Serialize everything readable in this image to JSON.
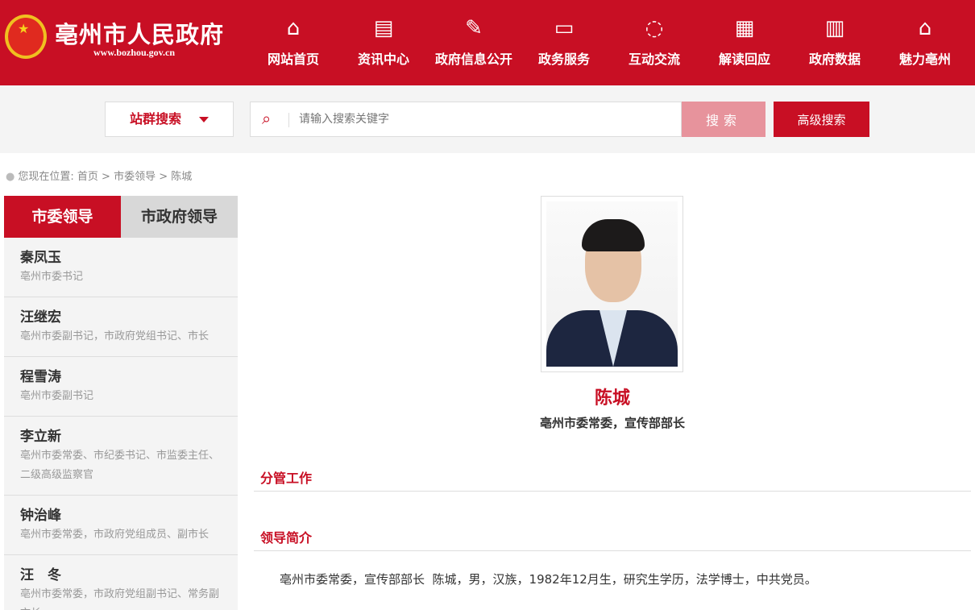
{
  "header": {
    "title": "亳州市人民政府",
    "url": "www.bozhou.gov.cn",
    "nav": [
      {
        "label": "网站首页",
        "icon": "home-icon",
        "glyph": "⌂"
      },
      {
        "label": "资讯中心",
        "icon": "news-icon",
        "glyph": "▤"
      },
      {
        "label": "政府信息公开",
        "icon": "edit-doc-icon",
        "glyph": "✎"
      },
      {
        "label": "政务服务",
        "icon": "monitor-icon",
        "glyph": "▭"
      },
      {
        "label": "互动交流",
        "icon": "chat-icon",
        "glyph": "◌"
      },
      {
        "label": "解读回应",
        "icon": "document-icon",
        "glyph": "▦"
      },
      {
        "label": "政府数据",
        "icon": "bar-chart-icon",
        "glyph": "▥"
      },
      {
        "label": "魅力亳州",
        "icon": "landmark-icon",
        "glyph": "⌂"
      }
    ]
  },
  "search": {
    "site_select": "站群搜索",
    "placeholder": "请输入搜索关键字",
    "value": "",
    "button": "搜索",
    "advanced": "高级搜索"
  },
  "breadcrumb": {
    "prefix": "您现在位置:",
    "items": [
      "首页",
      "市委领导",
      "陈城"
    ],
    "sep": ">"
  },
  "tabs": [
    "市委领导",
    "市政府领导"
  ],
  "leaders": [
    {
      "name": "秦凤玉",
      "title": "亳州市委书记"
    },
    {
      "name": "汪继宏",
      "title": "亳州市委副书记，市政府党组书记、市长"
    },
    {
      "name": "程雪涛",
      "title": "亳州市委副书记"
    },
    {
      "name": "李立新",
      "title": "亳州市委常委、市纪委书记、市监委主任、二级高级监察官"
    },
    {
      "name": "钟治峰",
      "title": "亳州市委常委，市政府党组成员、副市长"
    },
    {
      "name": "汪　冬",
      "title": "亳州市委常委，市政府党组副书记、常务副市长"
    }
  ],
  "profile": {
    "name": "陈城",
    "title": "亳州市委常委，宣传部部长",
    "sections": [
      "分管工作",
      "领导简介"
    ],
    "intro": "亳州市委常委，宣传部部长  陈城，男，汉族，1982年12月生，研究生学历，法学博士，中共党员。"
  },
  "colors": {
    "brand": "#c80f24",
    "search_btn": "#e7939c"
  }
}
